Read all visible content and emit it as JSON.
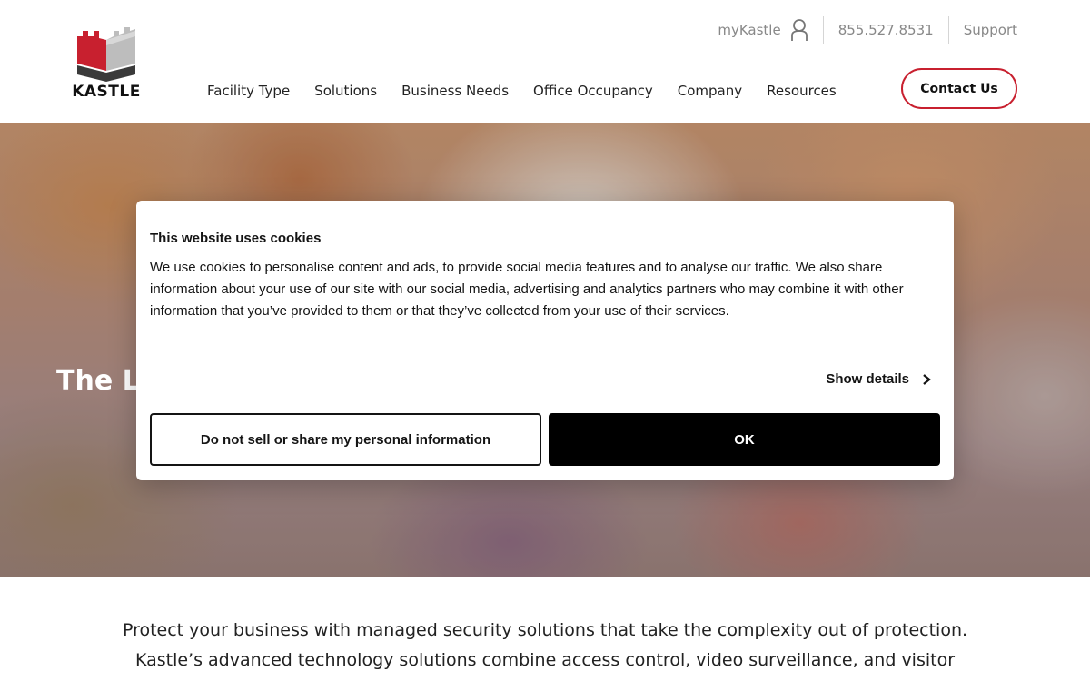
{
  "brand": {
    "name": "KASTLE",
    "accent_color": "#c8202f"
  },
  "utility_nav": {
    "my_kastle": "myKastle",
    "phone": "855.527.8531",
    "support": "Support"
  },
  "main_nav": {
    "items": [
      {
        "label": "Facility Type"
      },
      {
        "label": "Solutions"
      },
      {
        "label": "Business Needs"
      },
      {
        "label": "Office Occupancy"
      },
      {
        "label": "Company"
      },
      {
        "label": "Resources"
      }
    ],
    "cta": "Contact Us"
  },
  "hero": {
    "title_visible": "The Le"
  },
  "cookie_banner": {
    "title": "This website uses cookies",
    "body": "We use cookies to personalise content and ads, to provide social media features and to analyse our traffic. We also share information about your use of our site with our social media, advertising and analytics partners who may combine it with other information that you’ve provided to them or that they’ve collected from your use of their services.",
    "show_details": "Show details",
    "deny_button": "Do not sell or share my personal information",
    "ok_button": "OK"
  },
  "intro": {
    "line1": "Protect your business with managed security solutions that take the complexity out of protection.",
    "line2": "Kastle’s advanced technology solutions combine access control, video surveillance, and visitor"
  }
}
